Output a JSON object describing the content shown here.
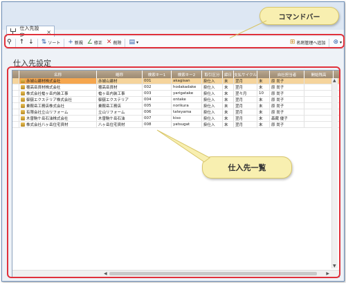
{
  "tab": {
    "title": "仕入先設定",
    "close": "×"
  },
  "toolbar": {
    "sort": "ソート",
    "new": "新規",
    "edit": "修正",
    "delete": "削除",
    "add_meishi": "名刺管理へ追加"
  },
  "page": {
    "title": "仕入先設定"
  },
  "callouts": {
    "command_bar": "コマンドバー",
    "list": "仕入先一覧"
  },
  "table": {
    "columns": [
      "名称",
      "略称",
      "検索キー1",
      "検索キー2",
      "取引区分",
      "締日",
      "支払サイクル",
      "",
      "自社担当者",
      "開始残高"
    ],
    "rows": [
      [
        "赤城山建材株式会社",
        "赤城山建材",
        "001",
        "akagisan",
        "掛仕入",
        "末",
        "翌月",
        "末",
        "原 尚子",
        ""
      ],
      [
        "穂高岳資材株式会社",
        "穂高岳資材",
        "002",
        "hodakadake",
        "掛仕入",
        "末",
        "翌月",
        "末",
        "原 尚子",
        ""
      ],
      [
        "株式会社槍ヶ岳内装工事",
        "槍ヶ岳内装工事",
        "003",
        "yarigatake",
        "掛仕入",
        "末",
        "翌々月",
        "10",
        "原 尚子",
        ""
      ],
      [
        "御嶽エクステリア株式会社",
        "御嶽エクステリア",
        "004",
        "ontake",
        "掛仕入",
        "末",
        "翌月",
        "末",
        "原 尚子",
        ""
      ],
      [
        "乗鞍岳工務店株式会社",
        "乗鞍岳工務店",
        "005",
        "norikura",
        "掛仕入",
        "末",
        "翌月",
        "末",
        "原 尚子",
        ""
      ],
      [
        "有限会社立山リフォーム",
        "立山リフォーム",
        "006",
        "tateyama",
        "掛仕入",
        "末",
        "翌月",
        "末",
        "原 尚子",
        ""
      ],
      [
        "木曽駒ケ岳石油株式会社",
        "木曽駒ケ岳石油",
        "007",
        "kiso",
        "掛仕入",
        "末",
        "翌月",
        "末",
        "森蔵 優子",
        ""
      ],
      [
        "株式会社八ヶ岳住宅資材",
        "八ヶ岳住宅資材",
        "008",
        "yatsugat",
        "掛仕入",
        "末",
        "翌月",
        "末",
        "原 尚子",
        ""
      ]
    ]
  },
  "colors": {
    "accent_red": "#e0303a",
    "bubble": "#f8efb0",
    "header": "#a8967e",
    "selected": "#f5d49c"
  }
}
